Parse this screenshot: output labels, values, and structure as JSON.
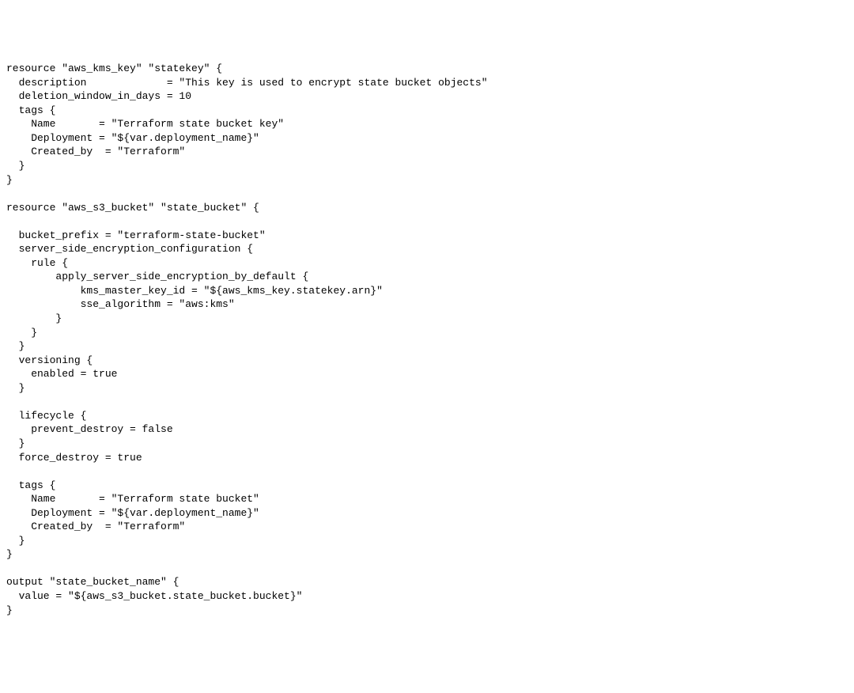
{
  "code": {
    "lines": [
      "resource \"aws_kms_key\" \"statekey\" {",
      "  description             = \"This key is used to encrypt state bucket objects\"",
      "  deletion_window_in_days = 10",
      "  tags {",
      "    Name       = \"Terraform state bucket key\"",
      "    Deployment = \"${var.deployment_name}\"",
      "    Created_by  = \"Terraform\"",
      "  }",
      "}",
      "",
      "resource \"aws_s3_bucket\" \"state_bucket\" {",
      "",
      "  bucket_prefix = \"terraform-state-bucket\"",
      "  server_side_encryption_configuration {",
      "    rule {",
      "        apply_server_side_encryption_by_default {",
      "            kms_master_key_id = \"${aws_kms_key.statekey.arn}\"",
      "            sse_algorithm = \"aws:kms\"",
      "        }",
      "    }",
      "  }",
      "  versioning {",
      "    enabled = true",
      "  }",
      "",
      "  lifecycle {",
      "    prevent_destroy = false",
      "  }",
      "  force_destroy = true",
      "",
      "  tags {",
      "    Name       = \"Terraform state bucket\"",
      "    Deployment = \"${var.deployment_name}\"",
      "    Created_by  = \"Terraform\"",
      "  }",
      "}",
      "",
      "output \"state_bucket_name\" {",
      "  value = \"${aws_s3_bucket.state_bucket.bucket}\"",
      "}"
    ]
  }
}
